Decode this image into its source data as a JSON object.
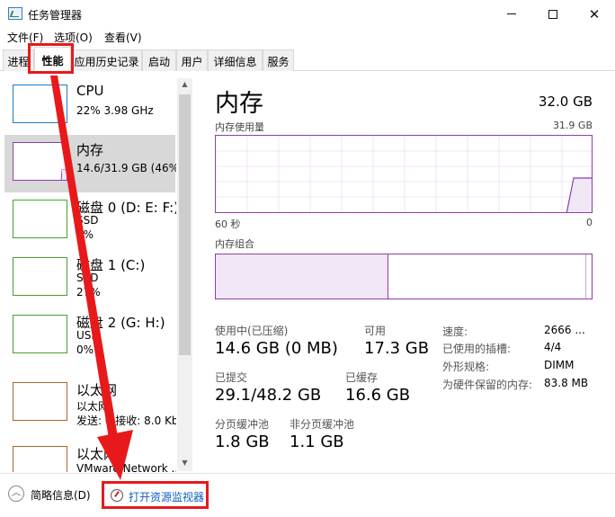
{
  "window": {
    "title": "任务管理器"
  },
  "menu": [
    "文件(F)",
    "选项(O)",
    "查看(V)"
  ],
  "tabs": [
    "进程",
    "性能",
    "应用历史记录",
    "启动",
    "用户",
    "详细信息",
    "服务"
  ],
  "left_items": [
    {
      "name": "CPU",
      "sub1": "22% 3.98 GHz",
      "sub2": "",
      "sub3": "",
      "color": "#1a7bc4"
    },
    {
      "name": "内存",
      "sub1": "14.6/31.9 GB (46%)",
      "sub2": "",
      "sub3": "",
      "color": "#8b3fa8"
    },
    {
      "name": "磁盘 0 (D: E: F:)",
      "sub1": "SSD",
      "sub2": "0%",
      "sub3": "",
      "color": "#4aa02c"
    },
    {
      "name": "磁盘 1 (C:)",
      "sub1": "SSD",
      "sub2": "27%",
      "sub3": "",
      "color": "#4aa02c"
    },
    {
      "name": "磁盘 2 (G: H:)",
      "sub1": "USB",
      "sub2": "0%",
      "sub3": "",
      "color": "#4aa02c"
    },
    {
      "name": "以太网",
      "sub1": "以太网",
      "sub2": "发送: 0 接收: 8.0 Kb",
      "sub3": "",
      "color": "#a7682b"
    },
    {
      "name": "以太网",
      "sub1": "VMware Network ...",
      "sub2": "",
      "sub3": "",
      "color": "#a7682b"
    }
  ],
  "main": {
    "title": "内存",
    "total": "32.0 GB",
    "usage_label": "内存使用量",
    "usage_max": "31.9 GB",
    "time_left": "60 秒",
    "time_right": "0",
    "composition_label": "内存组合",
    "usage_fraction": 0.46
  },
  "stats": {
    "in_use_label": "使用中(已压缩)",
    "in_use": "14.6 GB (0 MB)",
    "available_label": "可用",
    "available": "17.3 GB",
    "committed_label": "已提交",
    "committed": "29.1/48.2 GB",
    "cached_label": "已缓存",
    "cached": "16.6 GB",
    "paged_label": "分页缓冲池",
    "paged": "1.8 GB",
    "nonpaged_label": "非分页缓冲池",
    "nonpaged": "1.1 GB"
  },
  "details": [
    {
      "label": "速度:",
      "value": "2666 ..."
    },
    {
      "label": "已使用的插槽:",
      "value": "4/4"
    },
    {
      "label": "外形规格:",
      "value": "DIMM"
    },
    {
      "label": "为硬件保留的内存:",
      "value": "83.8 MB"
    }
  ],
  "footer": {
    "fewer_details": "简略信息(D)",
    "open_resmon": "打开资源监视器"
  },
  "icons": {
    "collapse": "chevron-up-icon",
    "resmon": "resource-monitor-icon",
    "app": "task-manager-icon"
  },
  "colors": {
    "memory": "#8b3fa8",
    "cpu": "#1a7bc4",
    "disk": "#4aa02c",
    "ethernet": "#a7682b",
    "annotation": "#e8191b",
    "link": "#0e5fb8"
  }
}
